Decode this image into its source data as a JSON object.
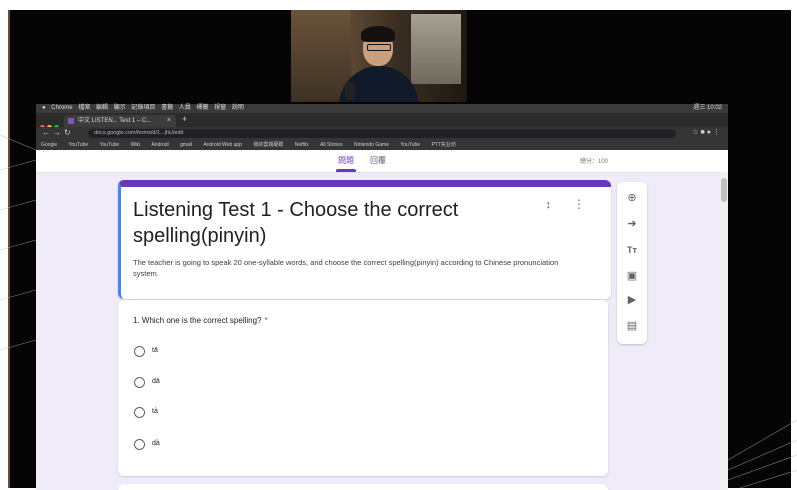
{
  "window": {
    "tab_title": "中文 LISTEN... Test 1 – C...",
    "url": "docs.google.com/forms/d/1...jhU/edit",
    "os_menu": [
      "Chrome",
      "檔案",
      "編輯",
      "顯示",
      "記錄項目",
      "書籤",
      "人員",
      "標籤",
      "視窗",
      "說明"
    ],
    "os_clock": "週三 10:02",
    "bookmarks": [
      "Google",
      "YouTube",
      "YouTube",
      "Wiki",
      "Android",
      "gmail",
      "Android Web app",
      "我的雲端硬碟",
      "Netflix",
      "All Stories",
      "Nintendo Game",
      "YouTube",
      "PTT实业坊"
    ]
  },
  "forms_header": {
    "tab_questions": "問題",
    "tab_responses": "回覆",
    "score": "總分：100"
  },
  "form": {
    "title": "Listening Test 1 - Choose the correct spelling(pinyin)",
    "description": "The teacher is going to speak 20 one-syllable words, and choose the correct spelling(pinyin) according to Chinese pronunciation system."
  },
  "question": {
    "text": "1. Which one is the correct spelling?",
    "required_mark": "*",
    "options": [
      "tā",
      "dā",
      "tà",
      "dà"
    ]
  },
  "toolbar": {
    "icons": [
      "add-question-icon",
      "import-questions-icon",
      "add-title-icon",
      "add-image-icon",
      "add-video-icon",
      "add-section-icon"
    ],
    "title_glyph": "Tт"
  }
}
